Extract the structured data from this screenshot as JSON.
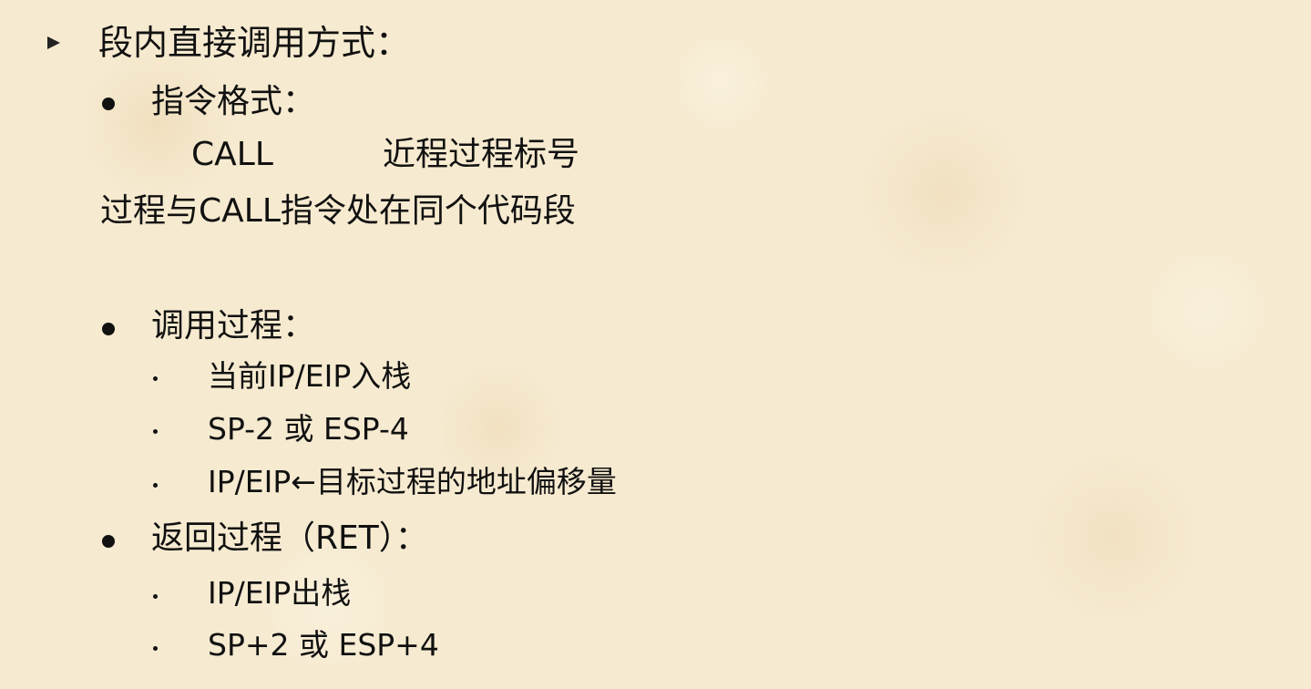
{
  "heading": "段内直接调用方式：",
  "format": {
    "label": "指令格式：",
    "instruction": "CALL",
    "operand": "近程过程标号",
    "note": "过程与CALL指令处在同个代码段"
  },
  "call_process": {
    "label": "调用过程：",
    "steps": [
      "当前IP/EIP入栈",
      "SP-2 或 ESP-4",
      "IP/EIP←目标过程的地址偏移量"
    ]
  },
  "return_process": {
    "label": "返回过程（RET）：",
    "steps": [
      "IP/EIP出栈",
      "SP+2 或 ESP+4"
    ]
  }
}
